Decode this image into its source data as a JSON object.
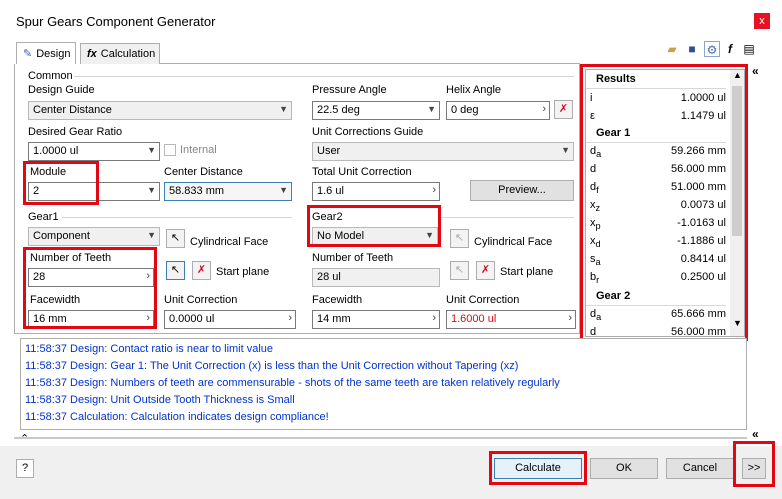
{
  "window": {
    "title": "Spur Gears Component Generator",
    "close": "x"
  },
  "tabs": [
    {
      "label": "Design"
    },
    {
      "label": "Calculation"
    }
  ],
  "common": {
    "group_label": "Common",
    "design_guide_label": "Design Guide",
    "design_guide_value": "Center Distance",
    "pressure_angle_label": "Pressure Angle",
    "pressure_angle_value": "22.5 deg",
    "helix_angle_label": "Helix Angle",
    "helix_angle_value": "0 deg",
    "gear_ratio_label": "Desired Gear Ratio",
    "gear_ratio_value": "1.0000 ul",
    "internal_label": "Internal",
    "unit_corr_guide_label": "Unit Corrections Guide",
    "unit_corr_guide_value": "User",
    "module_label": "Module",
    "module_value": "2",
    "center_distance_label": "Center Distance",
    "center_distance_value": "58.833 mm",
    "total_unit_corr_label": "Total Unit Correction",
    "total_unit_corr_value": "1.6 ul",
    "preview_label": "Preview..."
  },
  "gear1": {
    "group_label": "Gear1",
    "type_value": "Component",
    "cyl_face_label": "Cylindrical Face",
    "start_plane_label": "Start plane",
    "teeth_label": "Number of Teeth",
    "teeth_value": "28",
    "facewidth_label": "Facewidth",
    "facewidth_value": "16 mm",
    "unit_corr_label": "Unit Correction",
    "unit_corr_value": "0.0000 ul"
  },
  "gear2": {
    "group_label": "Gear2",
    "type_value": "No Model",
    "cyl_face_label": "Cylindrical Face",
    "start_plane_label": "Start plane",
    "teeth_label": "Number of Teeth",
    "teeth_value": "28 ul",
    "facewidth_label": "Facewidth",
    "facewidth_value": "14 mm",
    "unit_corr_label": "Unit Correction",
    "unit_corr_value": "1.6000 ul",
    "unit_corr_color": "#e30613"
  },
  "results": {
    "title": "Results",
    "rows": [
      {
        "name": "i",
        "value": "1.0000 ul"
      },
      {
        "name": "ε",
        "value": "1.1479 ul"
      }
    ],
    "gear1_label": "Gear 1",
    "gear1_rows": [
      {
        "name": "da",
        "value": "59.266 mm"
      },
      {
        "name": "d",
        "value": "56.000 mm"
      },
      {
        "name": "df",
        "value": "51.000 mm"
      },
      {
        "name": "xz",
        "value": "0.0073 ul"
      },
      {
        "name": "xp",
        "value": "-1.0163 ul"
      },
      {
        "name": "xd",
        "value": "-1.1886 ul"
      },
      {
        "name": "sa",
        "value": "0.8414 ul"
      },
      {
        "name": "br",
        "value": "0.2500 ul"
      }
    ],
    "gear2_label": "Gear 2",
    "gear2_rows": [
      {
        "name": "da",
        "value": "65.666 mm"
      },
      {
        "name": "d",
        "value": "56.000 mm"
      }
    ]
  },
  "messages": [
    "11:58:37 Design: Contact ratio is near to limit value",
    "11:58:37 Design: Gear 1: The Unit Correction (x) is less than the Unit Correction without Tapering (xz)",
    "11:58:37 Design: Numbers of teeth are commensurable - shots of the same teeth are taken relatively regularly",
    "11:58:37 Design: Unit Outside Tooth Thickness is Small",
    "11:58:37 Calculation: Calculation indicates design compliance!"
  ],
  "footer": {
    "help": "?",
    "calculate": "Calculate",
    "ok": "OK",
    "cancel": "Cancel",
    "more": ">>"
  },
  "colors": {
    "highlight": "#e30613",
    "message_text": "#0033cc"
  }
}
